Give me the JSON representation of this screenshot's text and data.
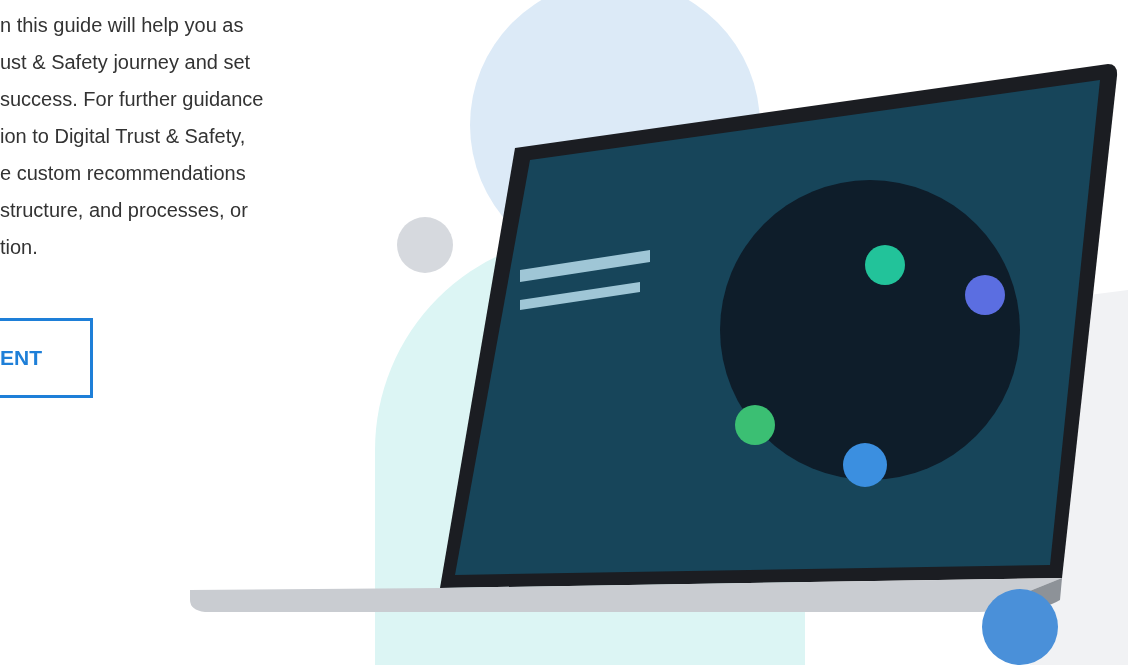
{
  "intro": {
    "lines": [
      "n this guide will help you as",
      "ust & Safety journey and set",
      "success. For further guidance",
      "ion to Digital Trust & Safety,",
      "e custom recommendations",
      "structure, and processes, or",
      "tion."
    ]
  },
  "button": {
    "label": "ENT"
  }
}
